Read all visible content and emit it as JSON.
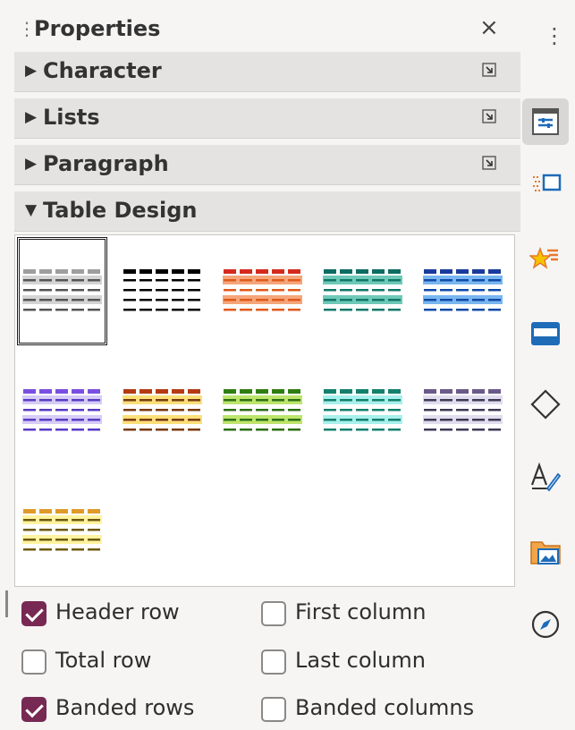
{
  "panel": {
    "title": "Properties",
    "close_glyph": "×",
    "grip_glyph": "⋮",
    "sections": [
      {
        "label": "Character",
        "expanded": false
      },
      {
        "label": "Lists",
        "expanded": false
      },
      {
        "label": "Paragraph",
        "expanded": false
      },
      {
        "label": "Table Design",
        "expanded": true
      }
    ],
    "table_styles": [
      {
        "header": "#9e9e9e",
        "band": "#d4d4d4",
        "body": "#555555",
        "selected": true
      },
      {
        "header": "#000000",
        "band": "#ffffff",
        "body": "#000000",
        "selected": false
      },
      {
        "header": "#d42a1e",
        "band": "#f5a67a",
        "body": "#e05a1c",
        "selected": false
      },
      {
        "header": "#0d6d63",
        "band": "#6ec9b9",
        "body": "#107868",
        "selected": false
      },
      {
        "header": "#1a3b9c",
        "band": "#79b6f0",
        "body": "#0f4aa8",
        "selected": false
      },
      {
        "header": "#7a4fe0",
        "band": "#d6ccf6",
        "body": "#5a3bc4",
        "selected": false
      },
      {
        "header": "#b43a14",
        "band": "#fbe07a",
        "body": "#7a3a10",
        "selected": false
      },
      {
        "header": "#2f7d12",
        "band": "#bde56d",
        "body": "#2c6f14",
        "selected": false
      },
      {
        "header": "#13806d",
        "band": "#a8f0ec",
        "body": "#13806d",
        "selected": false
      },
      {
        "header": "#6a5a8a",
        "band": "#e1dcee",
        "body": "#3d3a55",
        "selected": false
      },
      {
        "header": "#e09a2a",
        "band": "#fff3a0",
        "body": "#6e5a0e",
        "selected": false
      }
    ],
    "options": {
      "header_row": {
        "label": "Header row",
        "checked": true
      },
      "first_column": {
        "label": "First column",
        "checked": false
      },
      "total_row": {
        "label": "Total row",
        "checked": false
      },
      "last_column": {
        "label": "Last column",
        "checked": false
      },
      "banded_rows": {
        "label": "Banded rows",
        "checked": true
      },
      "banded_columns": {
        "label": "Banded columns",
        "checked": false
      }
    }
  },
  "tabbar": {
    "menu_glyph": "⋮",
    "tabs": [
      {
        "icon": "properties-icon",
        "active": true
      },
      {
        "icon": "page-icon",
        "active": false
      },
      {
        "icon": "styles-icon",
        "active": false
      },
      {
        "icon": "gallery-icon",
        "active": false
      },
      {
        "icon": "shapes-icon",
        "active": false
      },
      {
        "icon": "manage-changes-icon",
        "active": false
      },
      {
        "icon": "design-icon",
        "active": false
      },
      {
        "icon": "navigator-icon",
        "active": false
      }
    ]
  },
  "colors": {
    "accent": "#772953",
    "icon_blue": "#1e6bb8",
    "icon_orange": "#e8782a"
  }
}
